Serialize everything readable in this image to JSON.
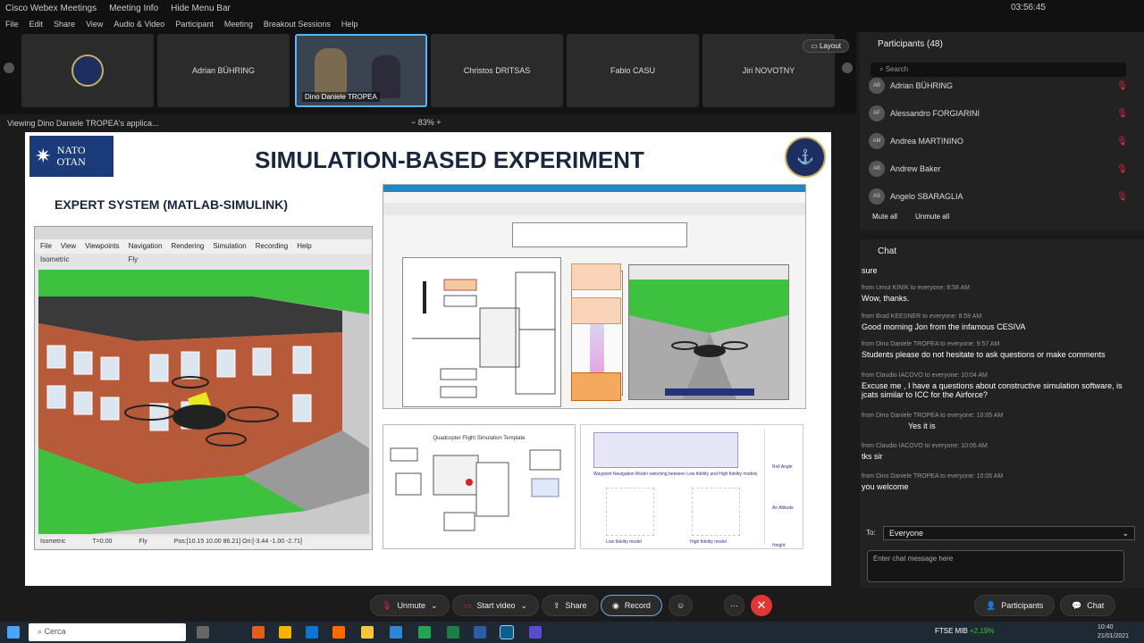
{
  "app": {
    "title": "Cisco Webex Meetings",
    "meeting_info": "Meeting Info",
    "hide_menu": "Hide Menu Bar",
    "clock": "03:56:45"
  },
  "menu": [
    "File",
    "Edit",
    "Share",
    "View",
    "Audio & Video",
    "Participant",
    "Meeting",
    "Breakout Sessions",
    "Help"
  ],
  "strip": {
    "tiles": [
      {
        "name": "",
        "type": "logo"
      },
      {
        "name": "Adrian BÜHRING"
      },
      {
        "name": "Dino Daniele TROPEA",
        "type": "video"
      },
      {
        "name": "Christos DRITSAS"
      },
      {
        "name": "Fabio CASU"
      },
      {
        "name": "Jiri NOVOTNY"
      }
    ],
    "layout_label": "Layout"
  },
  "share": {
    "viewing": "Viewing Dino Daniele TROPEA's applica...",
    "zoom": "83%"
  },
  "slide": {
    "nato_logo": [
      "NATO",
      "OTAN"
    ],
    "title": "SIMULATION-BASED EXPERIMENT",
    "subtitle": "EXPERT SYSTEM (MATLAB-SIMULINK)",
    "vr_menu": [
      "File",
      "View",
      "Viewpoints",
      "Navigation",
      "Rendering",
      "Simulation",
      "Recording",
      "Help"
    ],
    "vr_tools": [
      "Isometric",
      "Fly"
    ],
    "vr_status": [
      "Isometric",
      "T=0.00",
      "Fly",
      "Pos:[10.15 10.00 86.21] Ori:[-3.44 -1.00 -2.71]"
    ],
    "bottom1_title": "Quadcopter Flight Simulation Template",
    "bottom2_caption": "Waypoint Navigation Model switching between Low fidelity and High fidelity models",
    "bottom2_labels": [
      "Low fidelity model",
      "High fidelity model",
      "Roll Angle",
      "Air Altitude",
      "Height"
    ]
  },
  "participants": {
    "header": "Participants (48)",
    "search_placeholder": "Search",
    "list": [
      {
        "initials": "AB",
        "name": "Adrian BÜHRING"
      },
      {
        "initials": "AF",
        "name": "Alessandro FORGIARINI"
      },
      {
        "initials": "AM",
        "name": "Andrea MARTININO"
      },
      {
        "initials": "AB",
        "name": "Andrew Baker"
      },
      {
        "initials": "AS",
        "name": "Angelo SBARAGLIA"
      }
    ],
    "mute_all": "Mute all",
    "unmute_all": "Unmute all"
  },
  "chat": {
    "header": "Chat",
    "messages": [
      {
        "meta": "",
        "text": "sure"
      },
      {
        "meta": "from Umut KINIK to everyone:    8:58 AM",
        "text": "Wow, thanks."
      },
      {
        "meta": "from Brad KEESNER to everyone:    8:58 AM",
        "text": "Good morning Jon from the infamous CESIVA"
      },
      {
        "meta": "from Dino Daniele TROPEA to everyone:    9:57 AM",
        "text": "Students please do not hesitate to ask questions or make comments"
      },
      {
        "meta": "from Claudio IACOVO to everyone:    10:04 AM",
        "text": "Excuse me , I have a questions about constructive simulation software, is jcats similar to ICC for the Airforce?"
      },
      {
        "meta": "from Dino Daniele TROPEA to everyone:    10:05 AM",
        "text": "Yes it is"
      },
      {
        "meta": "from Claudio IACOVO to everyone:    10:05 AM",
        "text": "tks sir"
      },
      {
        "meta": "from Dino Daniele TROPEA to everyone:    10:05 AM",
        "text": "you welcome"
      }
    ],
    "to_label": "To:",
    "to_value": "Everyone",
    "input_placeholder": "Enter chat message here"
  },
  "controls": {
    "unmute": "Unmute",
    "start_video": "Start video",
    "share": "Share",
    "record": "Record",
    "participants": "Participants",
    "chat": "Chat"
  },
  "taskbar": {
    "search_placeholder": "Cerca",
    "ticker_name": "FTSE MIB",
    "ticker_change": "+2,19%",
    "time": "10:40",
    "date": "21/01/2021"
  }
}
